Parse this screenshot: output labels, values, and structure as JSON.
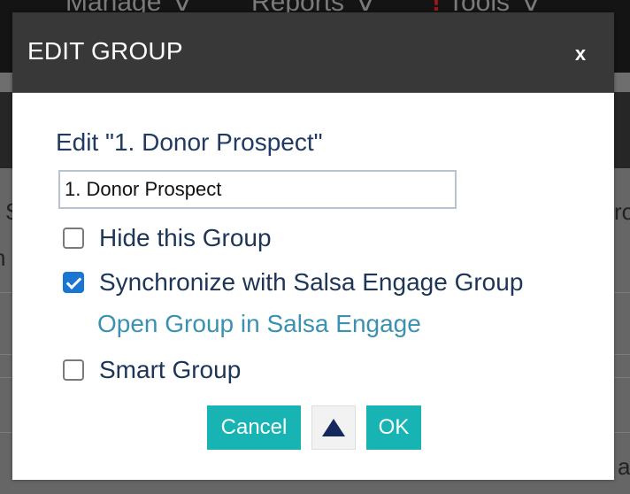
{
  "background": {
    "nav_items": [
      {
        "label": "Manage",
        "chevron": "chevron-down-icon"
      },
      {
        "label": "Reports",
        "chevron": "chevron-down-icon"
      },
      {
        "label": "Tools",
        "chevron": "chevron-down-icon",
        "alert": "!"
      }
    ],
    "partial_text_left_1": "S",
    "partial_text_left_2": "n s",
    "partial_text_right": "ro",
    "partial_text_right_2": "a"
  },
  "dialog": {
    "title": "EDIT GROUP",
    "close_label": "x",
    "heading": "Edit \"1. Donor Prospect\"",
    "name_value": "1. Donor Prospect",
    "options": {
      "hide_label": "Hide this Group",
      "hide_checked": false,
      "sync_label": "Synchronize with Salsa Engage Group",
      "sync_checked": true,
      "smart_label": "Smart Group",
      "smart_checked": false
    },
    "open_link": "Open Group in Salsa Engage",
    "buttons": {
      "cancel": "Cancel",
      "up_icon": "triangle-up-icon",
      "ok": "OK"
    }
  },
  "colors": {
    "header_bg": "#383838",
    "heading_text": "#203a63",
    "link": "#3b91b1",
    "button_teal": "#18b3b3",
    "checkbox_checked": "#1976d2",
    "up_triangle": "#14285e",
    "alert_red": "#a01818"
  }
}
